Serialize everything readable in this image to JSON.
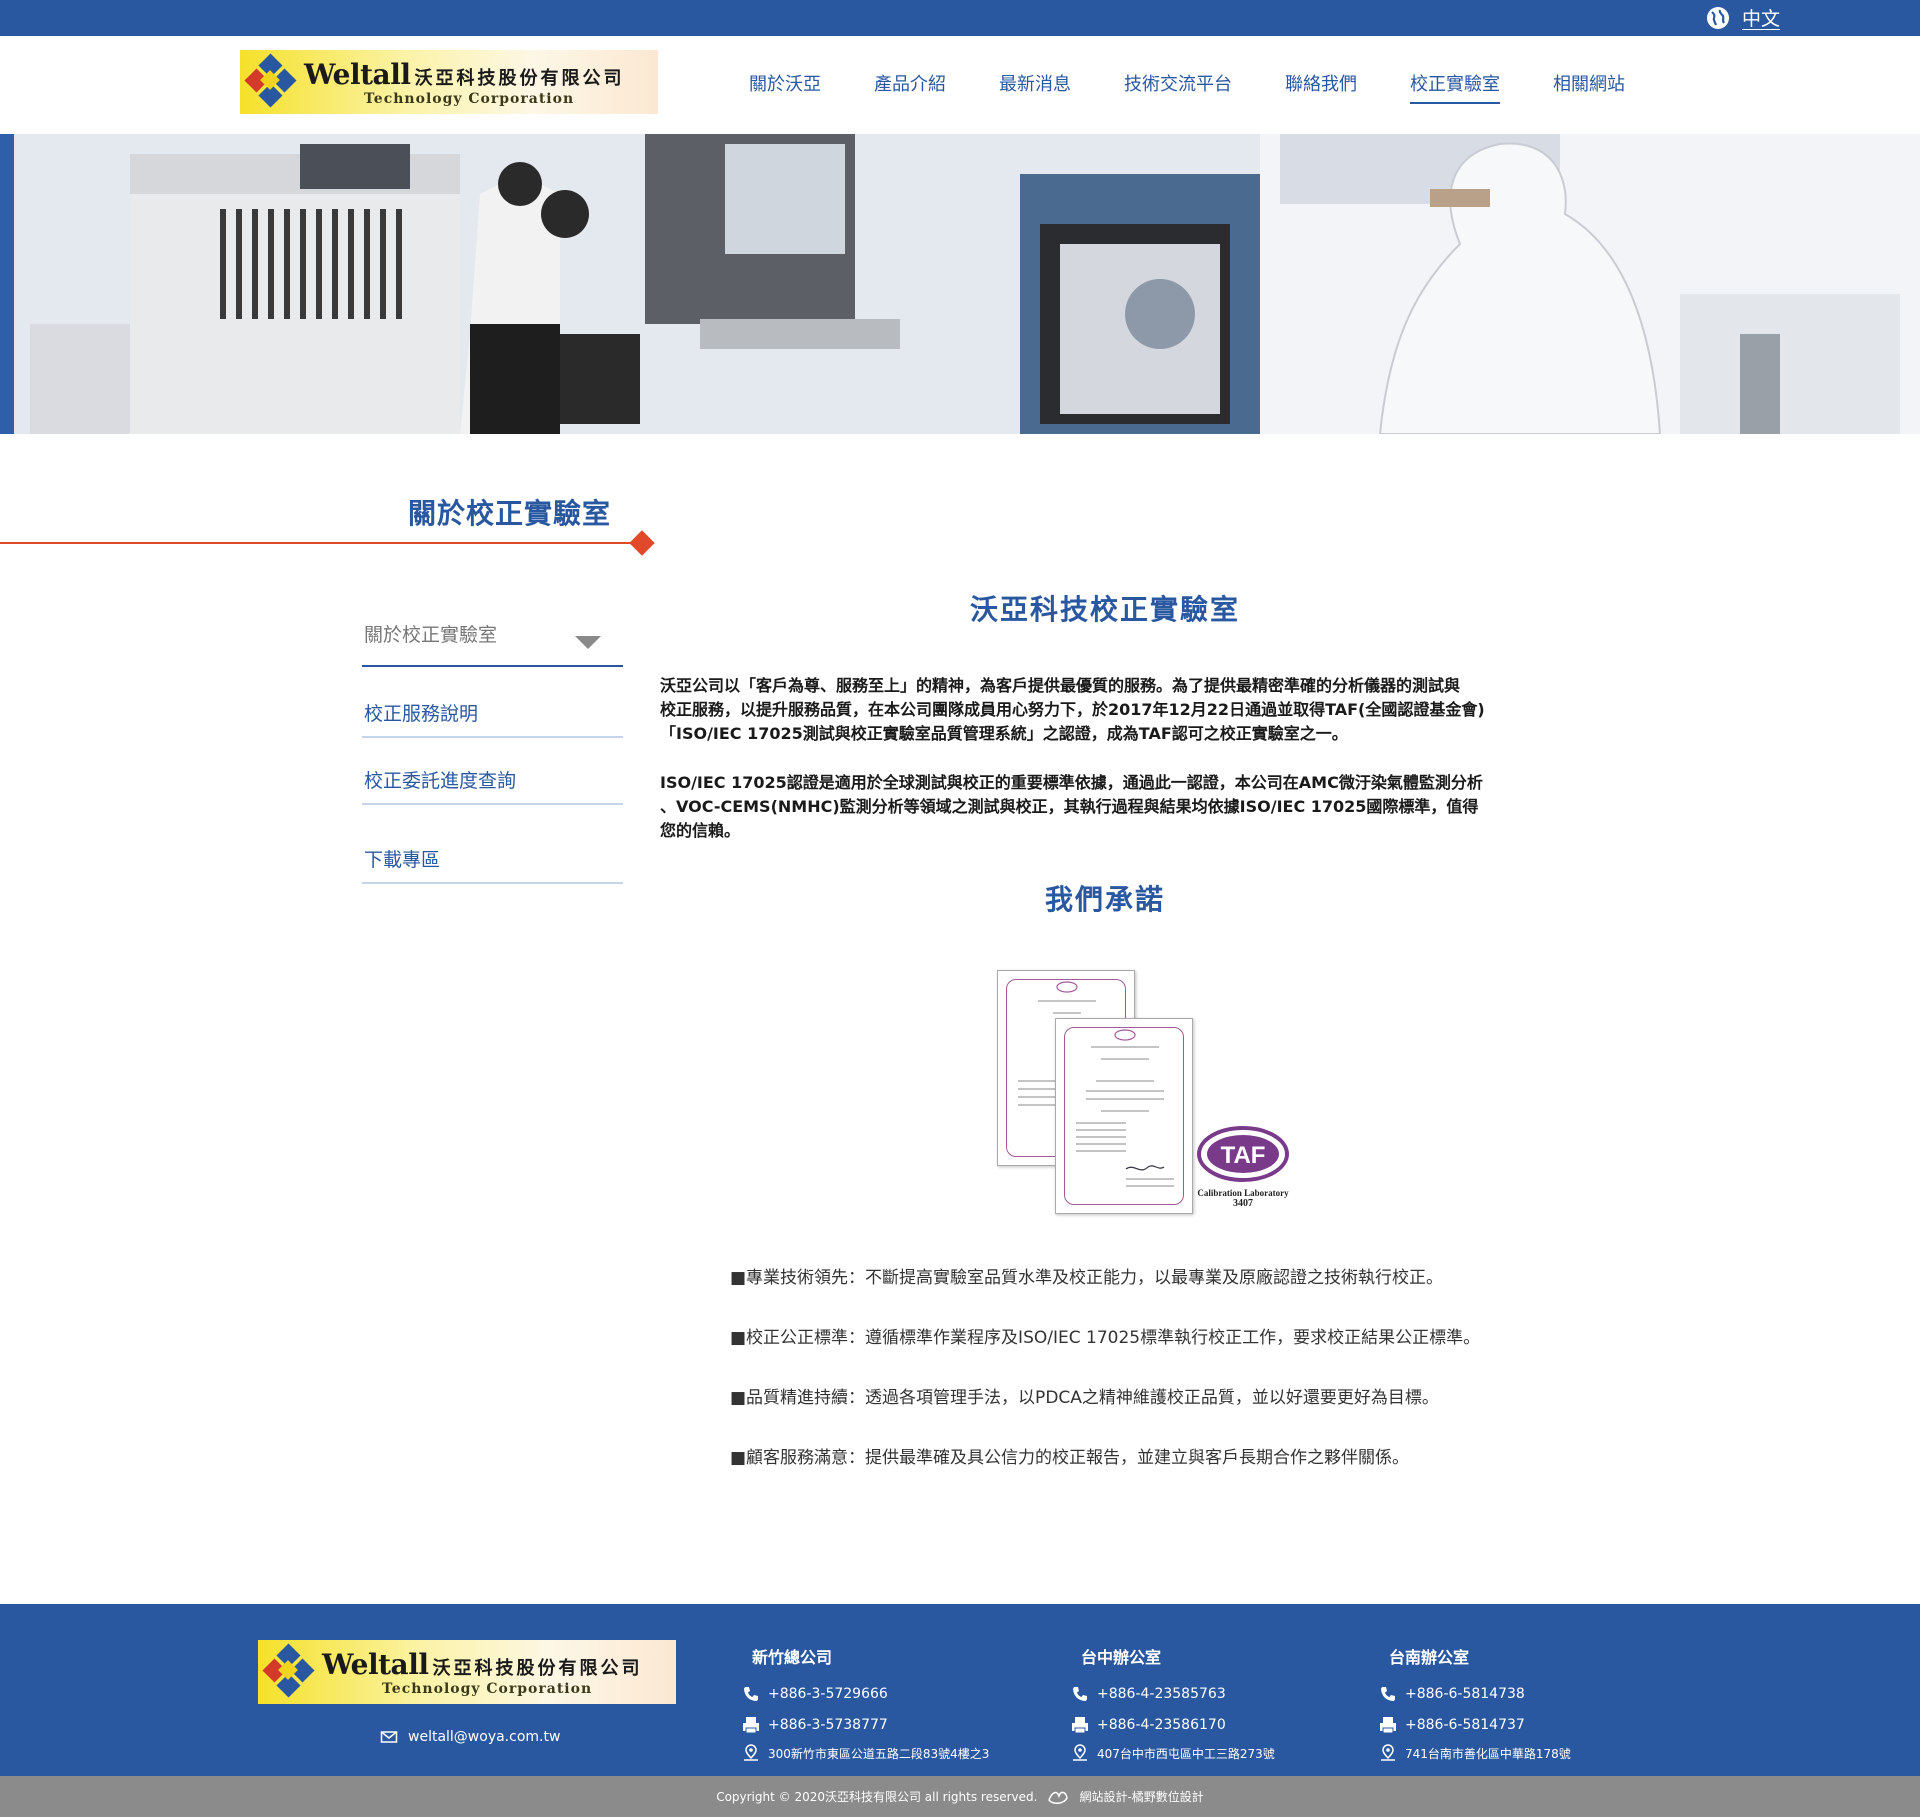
{
  "lang": {
    "label": "中文",
    "icon": "globe-icon"
  },
  "brand": {
    "name": "Weltall",
    "cn": "沃亞科技股份有限公司",
    "en": "Technology Corporation"
  },
  "nav": [
    {
      "label": "關於沃亞"
    },
    {
      "label": "產品介紹"
    },
    {
      "label": "最新消息"
    },
    {
      "label": "技術交流平台"
    },
    {
      "label": "聯絡我們"
    },
    {
      "label": "校正實驗室",
      "active": true
    },
    {
      "label": "相關網站"
    }
  ],
  "sidebar": {
    "title": "關於校正實驗室",
    "items": [
      {
        "label": "關於校正實驗室"
      },
      {
        "label": "校正服務說明"
      },
      {
        "label": "校正委託進度查詢"
      },
      {
        "label": "下載專區"
      }
    ]
  },
  "main": {
    "title": "沃亞科技校正實驗室",
    "para1": [
      "沃亞公司以「客戶為尊、服務至上」的精神，為客戶提供最優質的服務。為了提供最精密準確的分析儀器的測試與",
      "校正服務，以提升服務品質，在本公司團隊成員用心努力下，於2017年12月22日通過並取得TAF(全國認證基金會)",
      "「ISO/IEC 17025測試與校正實驗室品質管理系統」之認證，成為TAF認可之校正實驗室之一。"
    ],
    "para2": [
      "ISO/IEC 17025認證是適用於全球測試與校正的重要標準依據，通過此一認證，本公司在AMC微汙染氣體監測分析",
      "、VOC-CEMS(NMHC)監測分析等領域之測試與校正，其執行過程與結果均依據ISO/IEC 17025國際標準，值得",
      "您的信賴。"
    ],
    "promise_title": "我們承諾",
    "taf": {
      "logo": "TAF",
      "caption": "Calibration Laboratory",
      "number": "3407"
    },
    "bullets": [
      "■專業技術領先：不斷提高實驗室品質水準及校正能力，以最專業及原廠認證之技術執行校正。",
      "■校正公正標準：遵循標準作業程序及ISO/IEC 17025標準執行校正工作，要求校正結果公正標準。",
      "■品質精進持續：透過各項管理手法，以PDCA之精神維護校正品質，並以好還要更好為目標。",
      "■顧客服務滿意：提供最準確及具公信力的校正報告，並建立與客戶長期合作之夥伴關係。"
    ]
  },
  "footer": {
    "email": "weltall@woya.com.tw",
    "offices": [
      {
        "name": "新竹總公司",
        "tel": "+886-3-5729666",
        "fax": "+886-3-5738777",
        "addr": "300新竹市東區公道五路二段83號4樓之3"
      },
      {
        "name": "台中辦公室",
        "tel": "+886-4-23585763",
        "fax": "+886-4-23586170",
        "addr": "407台中市西屯區中工三路273號"
      },
      {
        "name": "台南辦公室",
        "tel": "+886-6-5814738",
        "fax": "+886-6-5814737",
        "addr": "741台南市善化區中華路178號"
      }
    ],
    "copyright": "Copyright © 2020沃亞科技有限公司 all rights reserved.",
    "design": "網站設計-橘野數位設計"
  },
  "colors": {
    "primary": "#2a58a0",
    "accent": "#e04a2a",
    "footer_bottom": "#8b8b8b"
  }
}
